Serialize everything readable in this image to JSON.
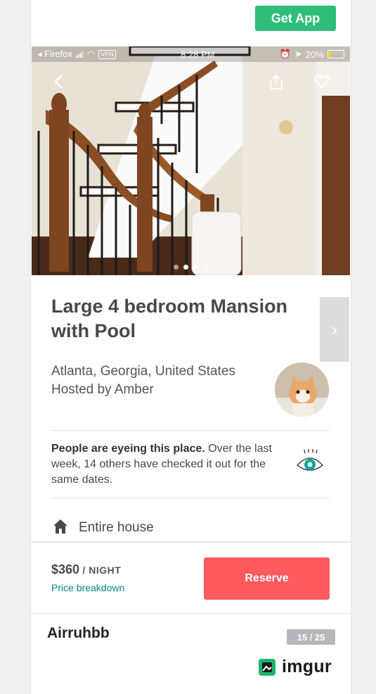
{
  "header": {
    "get_app_label": "Get App"
  },
  "status_bar": {
    "browser": "◂ Firefox",
    "vpn": "VPN",
    "time": "8:28 PM",
    "battery": "20%",
    "battery_level": 0.2
  },
  "gallery": {
    "dot_count": 4,
    "active_dot": 1,
    "photo_subject": "wooden staircase with iron balusters"
  },
  "listing": {
    "title": "Large 4 bedroom Mansion with Pool",
    "location": "Atlanta, Georgia, United States",
    "host": "Hosted by Amber",
    "notice_bold": "People are eyeing this place.",
    "notice_text": " Over the last week, 14 others have checked it out for the same dates.",
    "room_type": "Entire house"
  },
  "booking": {
    "price": "$360",
    "per": " / NIGHT",
    "breakdown": "Price breakdown",
    "reserve_label": "Reserve"
  },
  "post": {
    "title": "Airruhbb",
    "counter": "15 / 25",
    "brand": "imgur"
  },
  "colors": {
    "get_app": "#2fbd7a",
    "reserve": "#ff5a5f",
    "link": "#008489",
    "counter": "#b5b7bc"
  }
}
